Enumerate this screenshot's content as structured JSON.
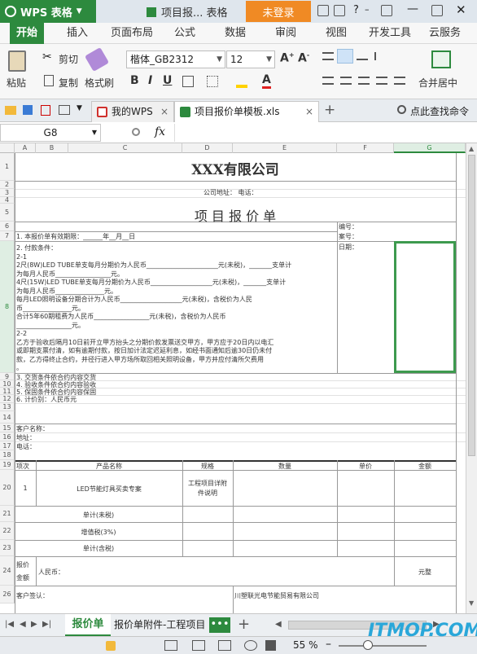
{
  "titlebar": {
    "app_name": "WPS 表格",
    "doc_title": "项目报... 表格",
    "login": "未登录"
  },
  "tabs": [
    "开始",
    "插入",
    "页面布局",
    "公式",
    "数据",
    "审阅",
    "视图",
    "开发工具",
    "云服务"
  ],
  "ribbon": {
    "paste": "粘贴",
    "cut": "剪切",
    "copy": "复制",
    "format_painter": "格式刷",
    "font": "楷体_GB2312",
    "size": "12",
    "merge": "合并居中"
  },
  "doctabs": {
    "home": "我的WPS",
    "file": "项目报价单模板.xls",
    "find": "点此查找命令"
  },
  "formula": {
    "cell_ref": "G8",
    "fx": "fx"
  },
  "columns": [
    "A",
    "B",
    "C",
    "D",
    "E",
    "F",
    "G"
  ],
  "sheet": {
    "company": "XXX有限公司",
    "address": "公司地址：    电话：",
    "title": "项 目 报 价 单",
    "bianhao": "编号：",
    "anhao": "案号：",
    "riqi": "日期：",
    "r7": "1. 本报价单有效期限：______年__月__日",
    "r8": [
      "2. 付款条件：",
      "2-1",
      "2尺(8W)LED TUBE单支每月分期价为人民币______________________元(未税)，_______支单计",
      "为每月人民币_________________元。",
      "4尺(15W)LED TUBE单支每月分期价为人民币___________________元(未税)，_______支单计",
      "为每月人民币_______________元。",
      "每月LED照明设备分期合计为人民币___________________元(未税)，含税价为人民",
      "币_______________元。",
      "合计5年60期租费为人民币_________________元(未税)，含税价为人民币",
      "_________________元。",
      "2-2",
      "乙方于验收后隔月10日前开立甲方抬头之分期价款发票送交甲方，甲方应于20日内以电汇",
      "或即期支票付清，如有逾期付款，按日加计法定迟延利息，如经书面通知后逾30日仍未付",
      "款，乙方得终止合约，并径行进入甲方场所取回相关照明设备，甲方并应付清所欠费用",
      "。"
    ],
    "r9": "3. 交货条件依合约内容交货",
    "r10": "4. 验收条件依合约内容验收",
    "r11": "5. 保固条件依合约内容保固",
    "r12": "6. 计价别：人民币元",
    "client": "客户名称：",
    "addr2": "地址：",
    "tel": "电话：",
    "headers": [
      "项次",
      "产品名称",
      "规格",
      "数量",
      "单价",
      "金额"
    ],
    "item_no": "1",
    "item_name": "LED节能灯具买卖专案",
    "item_spec": "工程项目详附件说明",
    "subtotal": "单计(未税)",
    "vat": "增值税(3%)",
    "total": "单计(含税)",
    "quote_label": "报价金额",
    "rmb": "人民币：",
    "yuan": "元整",
    "sign": "客户签认：",
    "seller": "川塑联光电节能贸易有限公司"
  },
  "sheettabs": {
    "tab1": "报价单",
    "tab2": "报价单附件-工程项目"
  },
  "statusbar": {
    "zoom": "55 %"
  },
  "watermark": "ITMOP.COM"
}
